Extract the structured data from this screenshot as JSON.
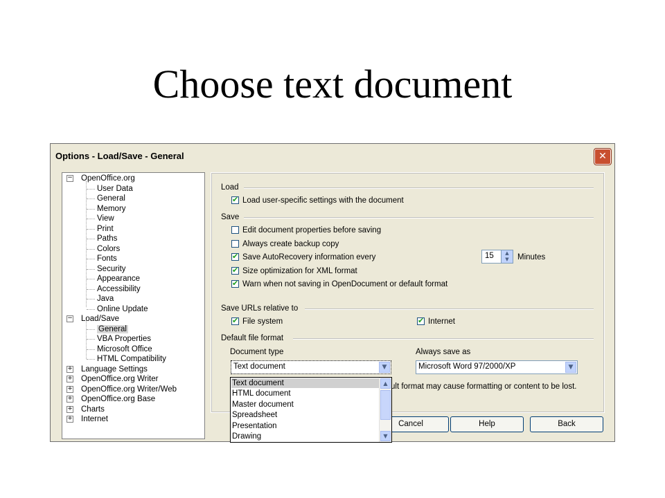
{
  "slide": {
    "title": "Choose text document"
  },
  "dialog": {
    "title": "Options - Load/Save - General",
    "close_glyph": "✕",
    "tree": [
      {
        "label": "OpenOffice.org",
        "expander": "−"
      },
      {
        "label": "User Data"
      },
      {
        "label": "General"
      },
      {
        "label": "Memory"
      },
      {
        "label": "View"
      },
      {
        "label": "Print"
      },
      {
        "label": "Paths"
      },
      {
        "label": "Colors"
      },
      {
        "label": "Fonts"
      },
      {
        "label": "Security"
      },
      {
        "label": "Appearance"
      },
      {
        "label": "Accessibility"
      },
      {
        "label": "Java"
      },
      {
        "label": "Online Update"
      },
      {
        "label": "Load/Save",
        "expander": "−"
      },
      {
        "label": "General",
        "selected": true
      },
      {
        "label": "VBA Properties"
      },
      {
        "label": "Microsoft Office"
      },
      {
        "label": "HTML Compatibility"
      },
      {
        "label": "Language Settings",
        "expander": "+"
      },
      {
        "label": "OpenOffice.org Writer",
        "expander": "+"
      },
      {
        "label": "OpenOffice.org Writer/Web",
        "expander": "+"
      },
      {
        "label": "OpenOffice.org Base",
        "expander": "+"
      },
      {
        "label": "Charts",
        "expander": "+"
      },
      {
        "label": "Internet",
        "expander": "+"
      }
    ],
    "load": {
      "heading": "Load",
      "user_settings": {
        "label": "Load user-specific settings with the document",
        "checked": true
      }
    },
    "save": {
      "heading": "Save",
      "edit_props": {
        "label": "Edit document properties before saving",
        "checked": false
      },
      "backup": {
        "label": "Always create backup copy",
        "checked": false
      },
      "autorecovery": {
        "label": "Save AutoRecovery information every",
        "checked": true
      },
      "autorecovery_minutes": "15",
      "minutes_label": "Minutes",
      "size_opt": {
        "label": "Size optimization for XML format",
        "checked": true
      },
      "warn": {
        "label": "Warn when not saving in OpenDocument or default format",
        "checked": true
      }
    },
    "urls": {
      "heading": "Save URLs relative to",
      "file_system": {
        "label": "File system",
        "checked": true
      },
      "internet": {
        "label": "Internet",
        "checked": true
      }
    },
    "default_format": {
      "heading": "Default file format",
      "doc_type_label": "Document type",
      "doc_type_value": "Text document",
      "always_save_label": "Always save as",
      "always_save_value": "Microsoft Word 97/2000/XP",
      "warning_tail": "ult format may cause formatting or content to be lost.",
      "dropdown_options": [
        "Text document",
        "HTML document",
        "Master document",
        "Spreadsheet",
        "Presentation",
        "Drawing"
      ]
    },
    "buttons": {
      "cancel": "Cancel",
      "help": "Help",
      "back": "Back"
    },
    "check_glyph": "✔",
    "arrow_down": "▼",
    "arrow_up": "▲"
  }
}
